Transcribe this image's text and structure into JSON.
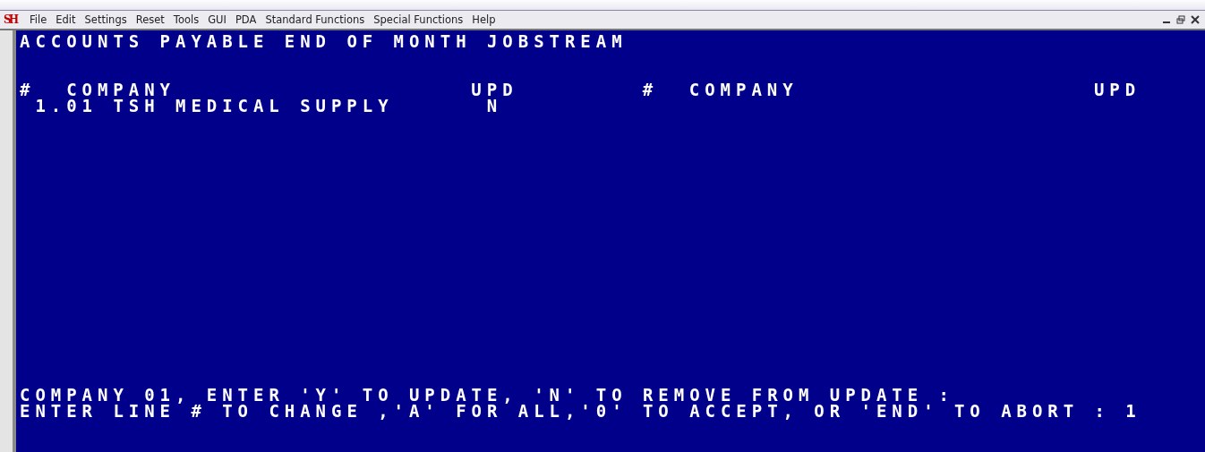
{
  "app_logo": "SH",
  "menu": [
    "File",
    "Edit",
    "Settings",
    "Reset",
    "Tools",
    "GUI",
    "PDA",
    "Standard Functions",
    "Special Functions",
    "Help"
  ],
  "screen": {
    "title": "ACCOUNTS PAYABLE END OF MONTH JOBSTREAM",
    "columns_left": [
      "#",
      "COMPANY",
      "UPD"
    ],
    "columns_right": [
      "#",
      "COMPANY",
      "UPD"
    ],
    "rows": [
      {
        "company": "1.01 TSH MEDICAL SUPPLY",
        "upd": "N"
      }
    ],
    "prompts": [
      "COMPANY 01, ENTER 'Y' TO UPDATE, 'N' TO REMOVE FROM UPDATE :",
      "ENTER LINE # TO CHANGE ,'A' FOR ALL,'0' TO ACCEPT, OR 'END' TO ABORT : 1"
    ]
  }
}
